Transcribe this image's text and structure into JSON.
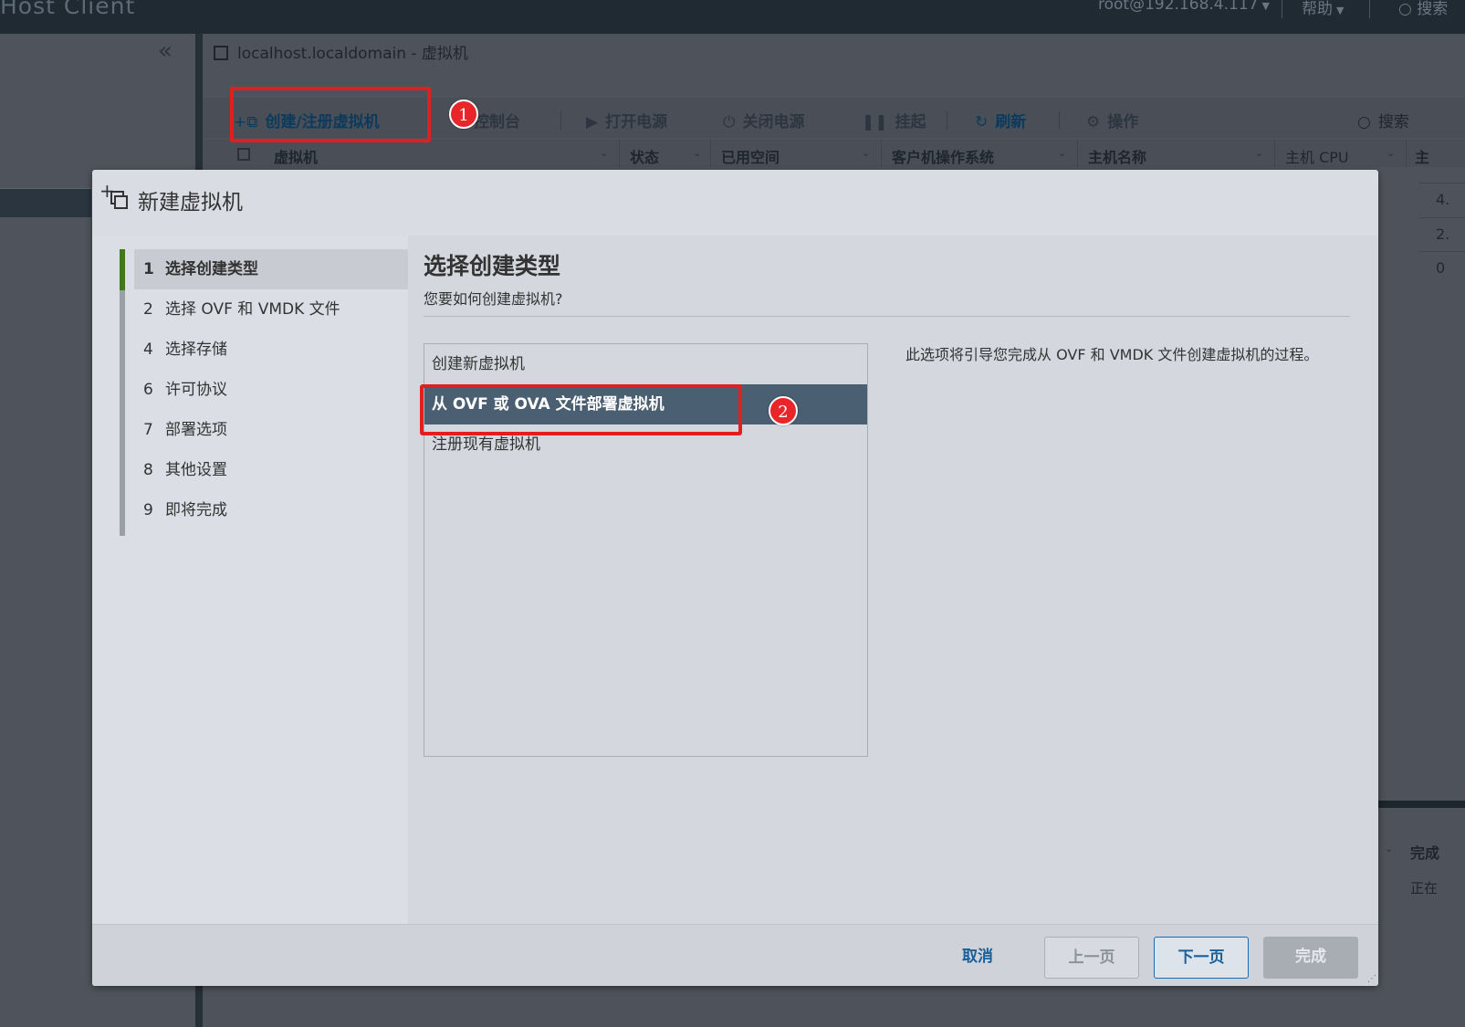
{
  "topbar": {
    "brand": "Host Client",
    "user": "root@192.168.4.117",
    "help": "帮助",
    "search": "搜索"
  },
  "breadcrumb": "localhost.localdomain - 虚拟机",
  "toolbar": {
    "create": "创建/注册虚拟机",
    "console": "控制台",
    "power_on": "打开电源",
    "power_off": "关闭电源",
    "suspend": "挂起",
    "refresh": "刷新",
    "actions": "操作",
    "search": "搜索"
  },
  "table": {
    "columns": [
      "虚拟机",
      "状态",
      "已用空间",
      "客户机操作系统",
      "主机名称",
      "主机 CPU",
      "主"
    ],
    "right_cells": [
      "4.",
      "2.",
      "0"
    ]
  },
  "recent_tasks": {
    "header": "完成",
    "cell": "正在"
  },
  "callouts": [
    "1",
    "2"
  ],
  "modal": {
    "title": "新建虚拟机",
    "steps": [
      {
        "num": "1",
        "label": "选择创建类型"
      },
      {
        "num": "2",
        "label": "选择 OVF 和 VMDK 文件"
      },
      {
        "num": "4",
        "label": "选择存储"
      },
      {
        "num": "6",
        "label": "许可协议"
      },
      {
        "num": "7",
        "label": "部署选项"
      },
      {
        "num": "8",
        "label": "其他设置"
      },
      {
        "num": "9",
        "label": "即将完成"
      }
    ],
    "heading": "选择创建类型",
    "question": "您要如何创建虚拟机?",
    "options": [
      "创建新虚拟机",
      "从 OVF 或 OVA 文件部署虚拟机",
      "注册现有虚拟机"
    ],
    "selected_option": "从 OVF 或 OVA 文件部署虚拟机",
    "description": "此选项将引导您完成从 OVF 和 VMDK 文件创建虚拟机的过程。",
    "buttons": {
      "cancel": "取消",
      "prev": "上一页",
      "next": "下一页",
      "finish": "完成"
    }
  },
  "colors": {
    "accent": "#1a5f98",
    "selected_option_bg": "#4a5f72",
    "active_step_mark": "#3e7a1c",
    "callout_red": "#e02020"
  }
}
